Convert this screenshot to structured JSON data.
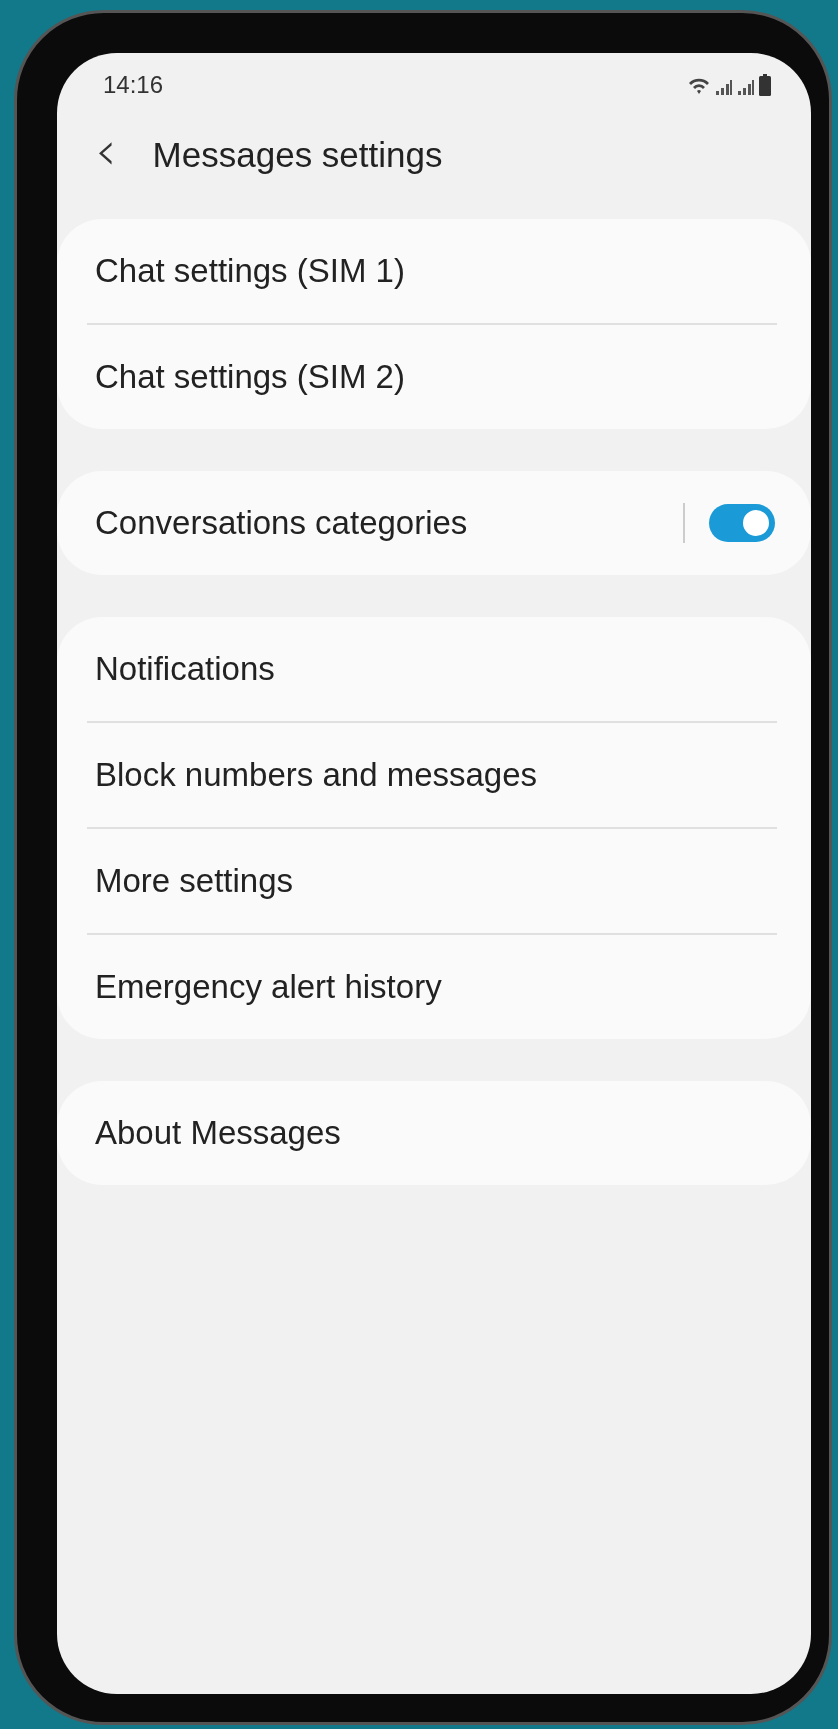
{
  "status_bar": {
    "time": "14:16"
  },
  "header": {
    "back": "‹",
    "title": "Messages settings"
  },
  "groups": [
    {
      "items": [
        {
          "kind": "link",
          "label": "Chat settings (SIM 1)"
        },
        {
          "kind": "link",
          "label": "Chat settings (SIM 2)"
        }
      ]
    },
    {
      "items": [
        {
          "kind": "toggle",
          "label": "Conversations categories",
          "on": true
        }
      ]
    },
    {
      "items": [
        {
          "kind": "link",
          "label": "Notifications"
        },
        {
          "kind": "link",
          "label": "Block numbers and messages"
        },
        {
          "kind": "link",
          "label": "More settings"
        },
        {
          "kind": "link",
          "label": "Emergency alert history"
        }
      ]
    },
    {
      "items": [
        {
          "kind": "link",
          "label": "About Messages"
        }
      ]
    }
  ]
}
